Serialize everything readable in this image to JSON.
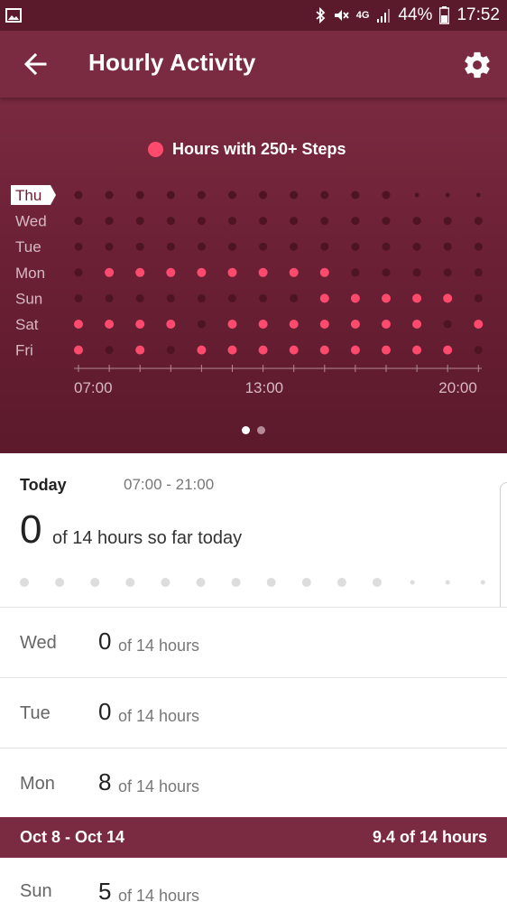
{
  "status_bar": {
    "battery": "44%",
    "time": "17:52",
    "network": "4G",
    "icons": [
      "image-icon",
      "bluetooth-icon",
      "mute-icon",
      "signal-icon",
      "battery-icon"
    ]
  },
  "app_bar": {
    "title": "Hourly Activity",
    "back_icon": "arrow-left-icon",
    "settings_icon": "gear-icon"
  },
  "legend": {
    "label": "Hours with 250+ Steps"
  },
  "colors": {
    "active_dot": "#ff4a6e",
    "inactive_dot": "#4e1422",
    "header_bg": "#7b2b41",
    "status_bg": "#5b1a2c"
  },
  "chart_data": {
    "type": "heatmap",
    "x_ticks": [
      "07:00",
      "13:00",
      "20:00"
    ],
    "hours": [
      "07:00",
      "08:00",
      "09:00",
      "10:00",
      "11:00",
      "12:00",
      "13:00",
      "14:00",
      "15:00",
      "16:00",
      "17:00",
      "18:00",
      "19:00",
      "20:00"
    ],
    "selected_day": "Thu",
    "days": [
      {
        "name": "Thu",
        "values": [
          0,
          0,
          0,
          0,
          0,
          0,
          0,
          0,
          0,
          0,
          0,
          null,
          null,
          null
        ]
      },
      {
        "name": "Wed",
        "values": [
          0,
          0,
          0,
          0,
          0,
          0,
          0,
          0,
          0,
          0,
          0,
          0,
          0,
          0
        ]
      },
      {
        "name": "Tue",
        "values": [
          0,
          0,
          0,
          0,
          0,
          0,
          0,
          0,
          0,
          0,
          0,
          0,
          0,
          0
        ]
      },
      {
        "name": "Mon",
        "values": [
          0,
          1,
          1,
          1,
          1,
          1,
          1,
          1,
          1,
          0,
          0,
          0,
          0,
          0
        ]
      },
      {
        "name": "Sun",
        "values": [
          0,
          0,
          0,
          0,
          0,
          0,
          0,
          0,
          1,
          1,
          1,
          1,
          1,
          0
        ]
      },
      {
        "name": "Sat",
        "values": [
          1,
          1,
          1,
          1,
          0,
          1,
          1,
          1,
          1,
          1,
          1,
          1,
          0,
          1
        ]
      },
      {
        "name": "Fri",
        "values": [
          1,
          0,
          1,
          0,
          1,
          1,
          1,
          1,
          1,
          1,
          1,
          1,
          1,
          0
        ]
      }
    ]
  },
  "pager": {
    "count": 2,
    "active": 0
  },
  "today": {
    "label": "Today",
    "range": "07:00 - 21:00",
    "count": "0",
    "suffix": "of 14 hours so far today",
    "hours_remaining_small_from": 11
  },
  "days_list": [
    {
      "name": "Wed",
      "count": "0",
      "suffix": "of 14 hours"
    },
    {
      "name": "Tue",
      "count": "0",
      "suffix": "of 14 hours"
    },
    {
      "name": "Mon",
      "count": "8",
      "suffix": "of 14 hours"
    }
  ],
  "week": {
    "range": "Oct 8 - Oct 14",
    "total": "9.4 of 14 hours"
  },
  "next_week_days": [
    {
      "name": "Sun",
      "count": "5",
      "suffix": "of 14 hours"
    }
  ]
}
